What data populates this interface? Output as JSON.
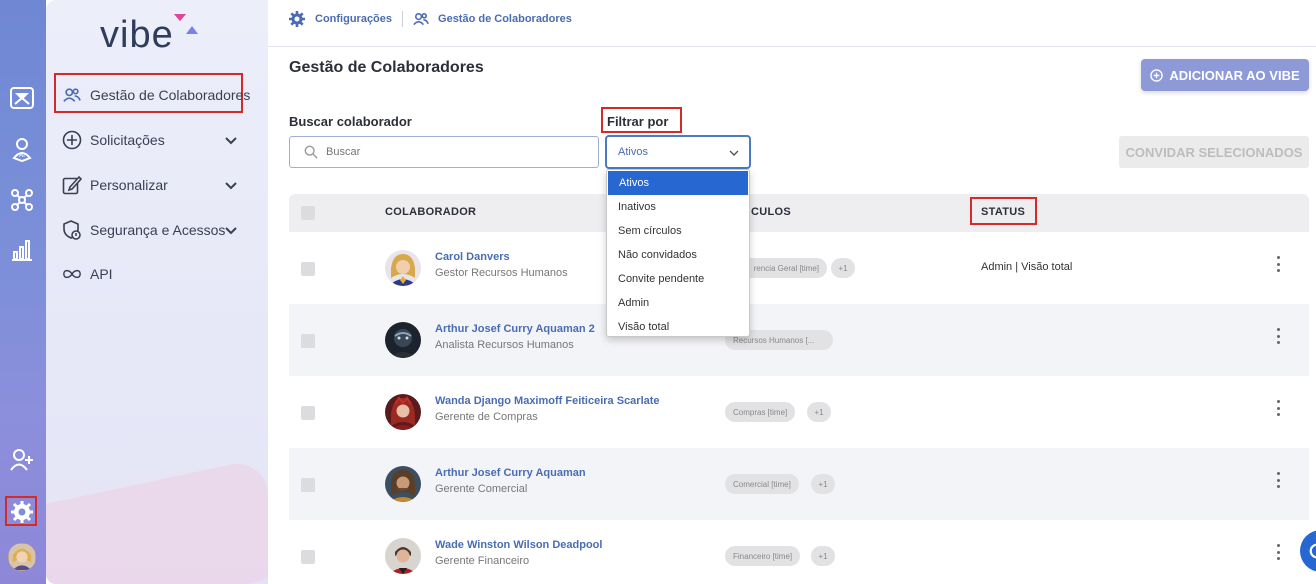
{
  "rail": {
    "icons": [
      "inbox-icon",
      "ai-person-icon",
      "network-icon",
      "chart-icon",
      "add-user-icon",
      "settings-icon",
      "user-avatar"
    ]
  },
  "sidebar": {
    "logo": "vibe",
    "items": [
      {
        "label": "Gestão de Colaboradores",
        "icon": "users-icon"
      },
      {
        "label": "Solicitações",
        "icon": "plus-circle-icon"
      },
      {
        "label": "Personalizar",
        "icon": "edit-icon"
      },
      {
        "label": "Segurança e Acessos",
        "icon": "shield-lock-icon"
      },
      {
        "label": "API",
        "icon": "infinity-icon"
      }
    ]
  },
  "breadcrumb": {
    "first": "Configurações",
    "second": "Gestão de Colaboradores"
  },
  "page": {
    "title": "Gestão de Colaboradores",
    "add_button": "ADICIONAR AO VIBE",
    "search_label": "Buscar colaborador",
    "search_placeholder": "Buscar",
    "filter_label": "Filtrar por",
    "filter_value": "Ativos",
    "invite_button": "CONVIDAR SELECIONADOS"
  },
  "filter_options": [
    "Ativos",
    "Inativos",
    "Sem círculos",
    "Não convidados",
    "Convite pendente",
    "Admin",
    "Visão total"
  ],
  "table": {
    "headers": {
      "colaborador": "COLABORADOR",
      "circulos": "CÍRCULOS",
      "circulos_visible": "CULOS",
      "status": "STATUS"
    },
    "rows": [
      {
        "name": "Carol Danvers",
        "role": "Gestor Recursos Humanos",
        "chip": "Gerencia Geral [time]",
        "chip_visible": "rencia Geral [time]",
        "more": "+1",
        "status": "Admin | Visão total"
      },
      {
        "name": "Arthur Josef Curry Aquaman 2",
        "role": "Analista Recursos Humanos",
        "chip": "Recursos Humanos [...",
        "more": "",
        "status": ""
      },
      {
        "name": "Wanda Django Maximoff Feiticeira Scarlate",
        "role": "Gerente de Compras",
        "chip": "Compras [time]",
        "more": "+1",
        "status": ""
      },
      {
        "name": "Arthur Josef Curry Aquaman",
        "role": "Gerente Comercial",
        "chip": "Comercial [time]",
        "more": "+1",
        "status": ""
      },
      {
        "name": "Wade Winston Wilson Deadpool",
        "role": "Gerente Financeiro",
        "chip": "Financeiro [time]",
        "more": "+1",
        "status": ""
      }
    ]
  },
  "colors": {
    "accent": "#4a6cb3",
    "rail": "#7a8fd8",
    "highlight": "#d42a2a",
    "selected": "#2667d1"
  }
}
